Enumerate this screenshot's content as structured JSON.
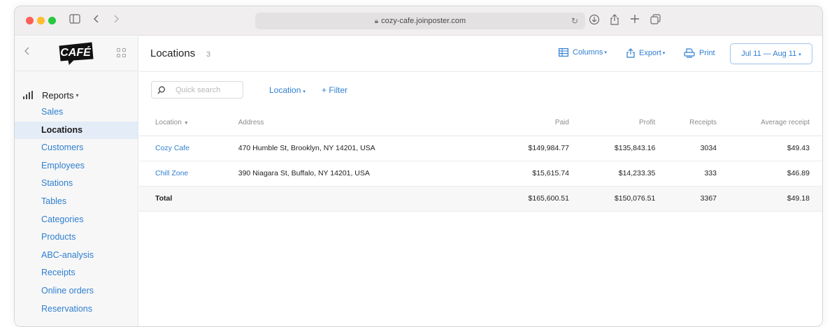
{
  "browser": {
    "url": "cozy-cafe.joinposter.com"
  },
  "brand": {
    "logo_text": "CAFÉ"
  },
  "sidebar": {
    "section_label": "Reports",
    "items": [
      {
        "label": "Sales"
      },
      {
        "label": "Locations"
      },
      {
        "label": "Customers"
      },
      {
        "label": "Employees"
      },
      {
        "label": "Stations"
      },
      {
        "label": "Tables"
      },
      {
        "label": "Categories"
      },
      {
        "label": "Products"
      },
      {
        "label": "ABC-analysis"
      },
      {
        "label": "Receipts"
      },
      {
        "label": "Online orders"
      },
      {
        "label": "Reservations"
      }
    ],
    "active_index": 1
  },
  "header": {
    "title": "Locations",
    "count": "3",
    "columns_label": "Columns",
    "export_label": "Export",
    "print_label": "Print",
    "date_range": "Jul 11 — Aug 11"
  },
  "toolbar": {
    "search_placeholder": "Quick search",
    "location_filter": "Location",
    "add_filter": "+ Filter"
  },
  "table": {
    "headers": {
      "location": "Location",
      "address": "Address",
      "paid": "Paid",
      "profit": "Profit",
      "receipts": "Receipts",
      "average": "Average receipt"
    },
    "rows": [
      {
        "location": "Cozy Cafe",
        "address": "470 Humble St, Brooklyn, NY 14201, USA",
        "paid": "$149,984.77",
        "profit": "$135,843.16",
        "receipts": "3034",
        "average": "$49.43"
      },
      {
        "location": "Chill Zone",
        "address": "390 Niagara St, Buffalo, NY 14201, USA",
        "paid": "$15,615.74",
        "profit": "$14,233.35",
        "receipts": "333",
        "average": "$46.89"
      }
    ],
    "total": {
      "label": "Total",
      "paid": "$165,600.51",
      "profit": "$150,076.51",
      "receipts": "3367",
      "average": "$49.18"
    }
  },
  "colors": {
    "accent": "#2f7fd0",
    "active_bg": "#e3ecf7"
  }
}
